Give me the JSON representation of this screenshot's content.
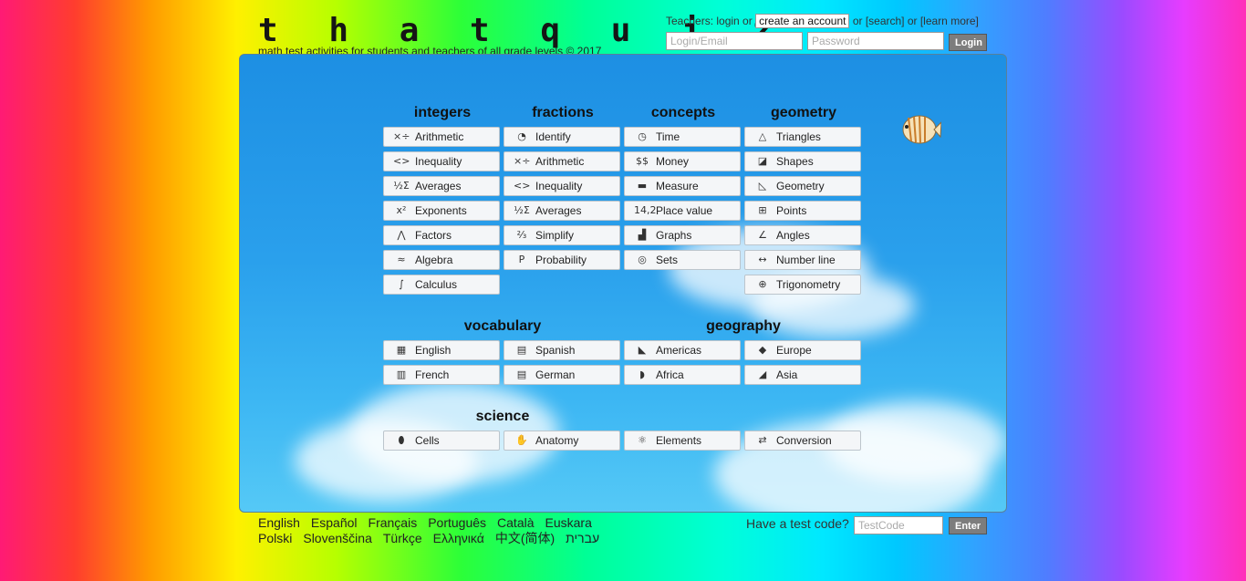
{
  "header": {
    "logo": "t h a t q u i z",
    "tagline": "math test activities for students and teachers of all grade levels © 2017",
    "teachers_prefix": "Teachers: login or",
    "create_account": "create an account",
    "teachers_middle": "or [search] or [learn more]",
    "login_placeholder": "Login/Email",
    "password_placeholder": "Password",
    "login_button": "Login"
  },
  "categories": {
    "integers": {
      "title": "integers",
      "items": [
        "Arithmetic",
        "Inequality",
        "Averages",
        "Exponents",
        "Factors",
        "Algebra",
        "Calculus"
      ]
    },
    "fractions": {
      "title": "fractions",
      "items": [
        "Identify",
        "Arithmetic",
        "Inequality",
        "Averages",
        "Simplify",
        "Probability"
      ]
    },
    "concepts": {
      "title": "concepts",
      "items": [
        "Time",
        "Money",
        "Measure",
        "Place value",
        "Graphs",
        "Sets"
      ]
    },
    "geometry": {
      "title": "geometry",
      "items": [
        "Triangles",
        "Shapes",
        "Geometry",
        "Points",
        "Angles",
        "Number line",
        "Trigonometry"
      ]
    },
    "vocabulary": {
      "title": "vocabulary",
      "items": [
        "English",
        "Spanish",
        "French",
        "German"
      ]
    },
    "geography": {
      "title": "geography",
      "items": [
        "Americas",
        "Europe",
        "Africa",
        "Asia"
      ]
    },
    "science": {
      "title": "science",
      "items": [
        "Cells",
        "Anatomy",
        "Elements",
        "Conversion"
      ]
    }
  },
  "footer": {
    "languages_row1": [
      "English",
      "Español",
      "Français",
      "Português",
      "Català",
      "Euskara"
    ],
    "languages_row2": [
      "Polski",
      "Slovenščina",
      "Türkçe",
      "Ελληνικά",
      "中文(简体)",
      "עברית"
    ],
    "test_code_label": "Have a test code?",
    "test_code_placeholder": "TestCode",
    "enter_button": "Enter"
  }
}
